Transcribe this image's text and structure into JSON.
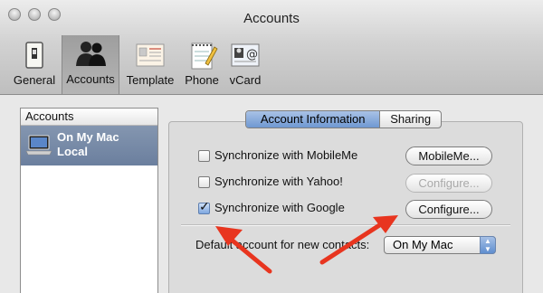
{
  "window": {
    "title": "Accounts"
  },
  "toolbar": {
    "items": [
      {
        "label": "General",
        "icon": "switch-icon"
      },
      {
        "label": "Accounts",
        "icon": "people-icon"
      },
      {
        "label": "Template",
        "icon": "template-card-icon"
      },
      {
        "label": "Phone",
        "icon": "notepad-pencil-icon"
      },
      {
        "label": "vCard",
        "icon": "vcard-icon"
      }
    ],
    "selected": "Accounts"
  },
  "sidebar": {
    "header": "Accounts",
    "accounts": [
      {
        "name": "On My Mac",
        "subtitle": "Local",
        "icon": "laptop-icon"
      }
    ]
  },
  "tabs": [
    {
      "label": "Account Information",
      "active": true
    },
    {
      "label": "Sharing",
      "active": false
    }
  ],
  "sync": [
    {
      "label": "Synchronize with MobileMe",
      "checked": false,
      "button": "MobileMe...",
      "button_enabled": true
    },
    {
      "label": "Synchronize with Yahoo!",
      "checked": false,
      "button": "Configure...",
      "button_enabled": false
    },
    {
      "label": "Synchronize with Google",
      "checked": true,
      "button": "Configure...",
      "button_enabled": true
    }
  ],
  "default_account": {
    "label": "Default account for new contacts:",
    "value": "On My Mac"
  },
  "annotations": {
    "arrow_color": "#e8351f"
  }
}
